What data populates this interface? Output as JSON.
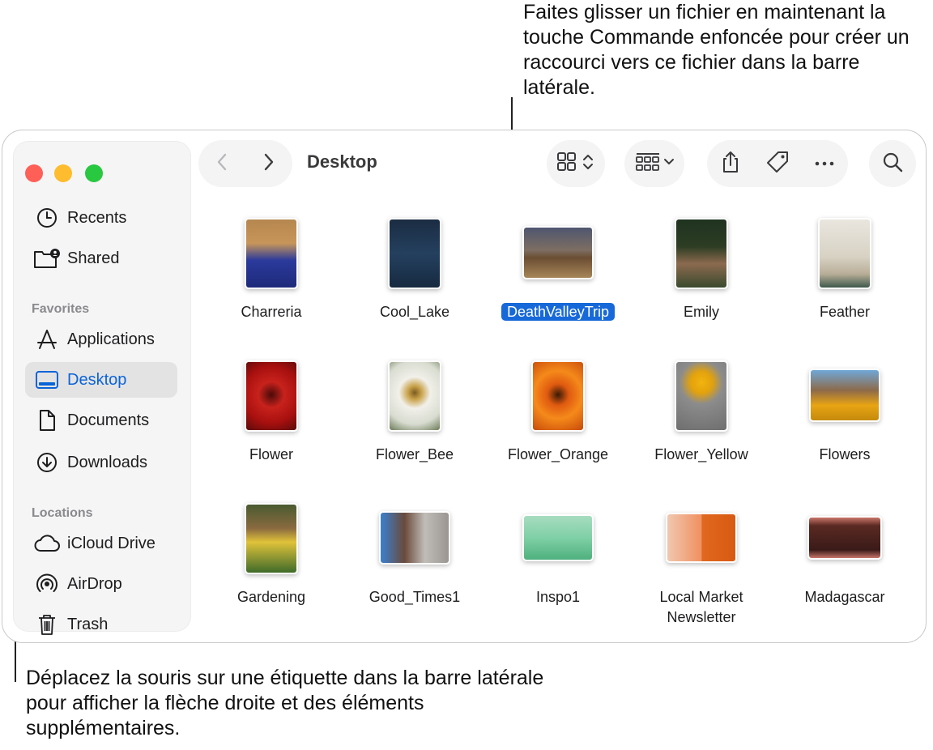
{
  "callouts": {
    "top": "Faites glisser un fichier en maintenant la touche Commande enfoncée pour créer un raccourci vers ce fichier dans la barre latérale.",
    "bottom": "Déplacez la souris sur une étiquette dans la barre latérale pour afficher la flèche droite et des éléments supplémentaires."
  },
  "window": {
    "title": "Desktop"
  },
  "sidebar": {
    "items_top": [
      {
        "label": "Recents",
        "icon": "clock-icon"
      },
      {
        "label": "Shared",
        "icon": "shared-folder-icon"
      }
    ],
    "favorites_header": "Favorites",
    "favorites": [
      {
        "label": "Applications",
        "icon": "applications-icon"
      },
      {
        "label": "Desktop",
        "icon": "desktop-icon",
        "selected": true
      },
      {
        "label": "Documents",
        "icon": "document-icon"
      },
      {
        "label": "Downloads",
        "icon": "download-icon"
      }
    ],
    "locations_header": "Locations",
    "locations": [
      {
        "label": "iCloud Drive",
        "icon": "cloud-icon"
      },
      {
        "label": "AirDrop",
        "icon": "airdrop-icon"
      },
      {
        "label": "Trash",
        "icon": "trash-icon"
      }
    ]
  },
  "files": [
    {
      "name": "Charreria"
    },
    {
      "name": "Cool_Lake"
    },
    {
      "name": "DeathValleyTrip",
      "selected": true
    },
    {
      "name": "Emily"
    },
    {
      "name": "Feather"
    },
    {
      "name": "Flower"
    },
    {
      "name": "Flower_Bee"
    },
    {
      "name": "Flower_Orange"
    },
    {
      "name": "Flower_Yellow"
    },
    {
      "name": "Flowers"
    },
    {
      "name": "Gardening"
    },
    {
      "name": "Good_Times1"
    },
    {
      "name": "Inspo1"
    },
    {
      "name": "Local Market Newsletter"
    },
    {
      "name": "Madagascar"
    }
  ],
  "colors": {
    "accent": "#1769d9",
    "sidebar_selected_text": "#0a64d8"
  }
}
